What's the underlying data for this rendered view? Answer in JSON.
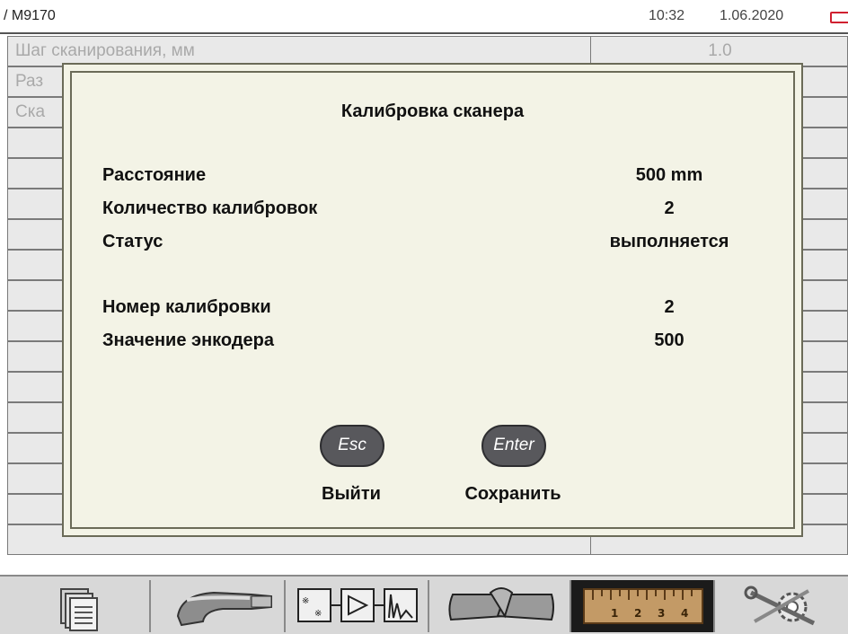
{
  "header": {
    "device": "/ M9170",
    "time": "10:32",
    "date": "1.06.2020",
    "battery_icon": "battery-low-icon",
    "battery_color": "#d02030"
  },
  "background_table": {
    "rows": [
      {
        "name": "Шаг сканирования, мм",
        "value": "1.0"
      },
      {
        "name": "Раз",
        "value": ""
      },
      {
        "name": "Ска",
        "value": ""
      },
      {
        "name": "",
        "value": ""
      },
      {
        "name": "",
        "value": ""
      },
      {
        "name": "",
        "value": ""
      },
      {
        "name": "",
        "value": ""
      },
      {
        "name": "",
        "value": ""
      },
      {
        "name": "",
        "value": ""
      },
      {
        "name": "",
        "value": ""
      },
      {
        "name": "",
        "value": ""
      },
      {
        "name": "",
        "value": ""
      },
      {
        "name": "",
        "value": ""
      },
      {
        "name": "",
        "value": ""
      },
      {
        "name": "",
        "value": ""
      },
      {
        "name": "",
        "value": ""
      },
      {
        "name": "",
        "value": ""
      }
    ]
  },
  "dialog": {
    "title": "Калибровка сканера",
    "params": [
      {
        "label": "Расстояние",
        "value": "500 mm"
      },
      {
        "label": "Количество калибровок",
        "value": "2"
      },
      {
        "label": "Статус",
        "value": "выполняется"
      },
      {
        "label": "Номер калибровки",
        "value": "2"
      },
      {
        "label": "Значение энкодера",
        "value": "500"
      }
    ],
    "buttons": {
      "esc": {
        "key": "Esc",
        "label": "Выйти"
      },
      "enter": {
        "key": "Enter",
        "label": "Сохранить"
      }
    }
  },
  "toolbar": {
    "items": [
      {
        "icon": "documents-icon"
      },
      {
        "icon": "probe-icon"
      },
      {
        "icon": "signal-processing-icon"
      },
      {
        "icon": "weld-joint-icon"
      },
      {
        "icon": "ruler-icon",
        "active": true,
        "ruler_marks": [
          "1",
          "2",
          "3",
          "4"
        ]
      },
      {
        "icon": "settings-tools-icon"
      }
    ]
  }
}
